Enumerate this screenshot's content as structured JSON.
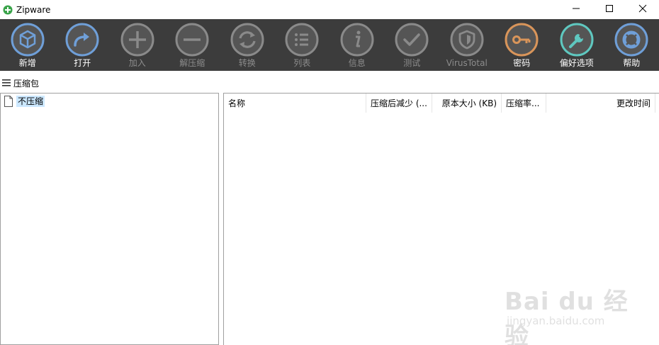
{
  "window": {
    "title": "Zipware",
    "controls": [
      "minimize",
      "maximize",
      "close"
    ]
  },
  "toolbar": {
    "items": [
      {
        "label": "新增",
        "icon": "cube-icon",
        "enabled": true,
        "ring": "#6f9fd8"
      },
      {
        "label": "打开",
        "icon": "share-arrow-icon",
        "enabled": true,
        "ring": "#6f9fd8"
      },
      {
        "label": "加入",
        "icon": "plus-icon",
        "enabled": false,
        "ring": "#8a8a8a"
      },
      {
        "label": "解压缩",
        "icon": "minus-icon",
        "enabled": false,
        "ring": "#8a8a8a"
      },
      {
        "label": "转换",
        "icon": "refresh-icon",
        "enabled": false,
        "ring": "#8a8a8a"
      },
      {
        "label": "列表",
        "icon": "list-icon",
        "enabled": false,
        "ring": "#8a8a8a"
      },
      {
        "label": "信息",
        "icon": "info-icon",
        "enabled": false,
        "ring": "#8a8a8a"
      },
      {
        "label": "测试",
        "icon": "check-icon",
        "enabled": false,
        "ring": "#8a8a8a"
      },
      {
        "label": "VirusTotal",
        "icon": "shield-icon",
        "enabled": false,
        "ring": "#8a8a8a"
      },
      {
        "label": "密码",
        "icon": "key-icon",
        "enabled": true,
        "ring": "#d9955a"
      },
      {
        "label": "偏好选项",
        "icon": "wrench-icon",
        "enabled": true,
        "ring": "#5fc8c0"
      },
      {
        "label": "帮助",
        "icon": "lifebuoy-icon",
        "enabled": true,
        "ring": "#6f9fd8"
      }
    ]
  },
  "archive_bar": {
    "label": "压缩包"
  },
  "tree": {
    "items": [
      {
        "label": "不压缩",
        "icon": "document-icon",
        "selected": true
      }
    ]
  },
  "file_list": {
    "columns": [
      "名称",
      "压缩后减少 (...",
      "原本大小 (KB)",
      "压缩率...",
      "更改时间"
    ],
    "rows": []
  },
  "watermark": {
    "brand": "Bai du 经验",
    "sub": "jingyan.baidu.com"
  },
  "colors": {
    "toolbar_bg": "#3c3c3c",
    "selection": "#cce8ff",
    "disabled_text": "#8c8c8c"
  }
}
